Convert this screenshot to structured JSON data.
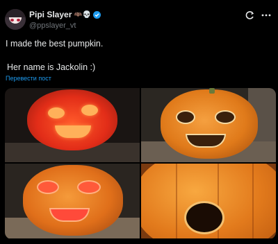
{
  "header": {
    "display_name": "Pipi Slayer",
    "emoji": "🦇💀",
    "handle": "@ppslayer_vt"
  },
  "tweet": {
    "line1": "I made the best pumpkin.",
    "line2": "Her name is Jackolin :)",
    "translate_label": "Перевести пост"
  },
  "icons": {
    "grok": "grok-icon",
    "more": "more-icon",
    "verified": "verified-badge-icon"
  },
  "colors": {
    "accent": "#1d9bf0",
    "background": "#000000",
    "text": "#e7e9ea",
    "muted": "#71767b"
  },
  "media": {
    "count": 4,
    "images": [
      "pumpkin-photo-glowing",
      "pumpkin-photo-daylight",
      "pumpkin-photo-lit-face",
      "pumpkin-photo-closeup"
    ]
  }
}
